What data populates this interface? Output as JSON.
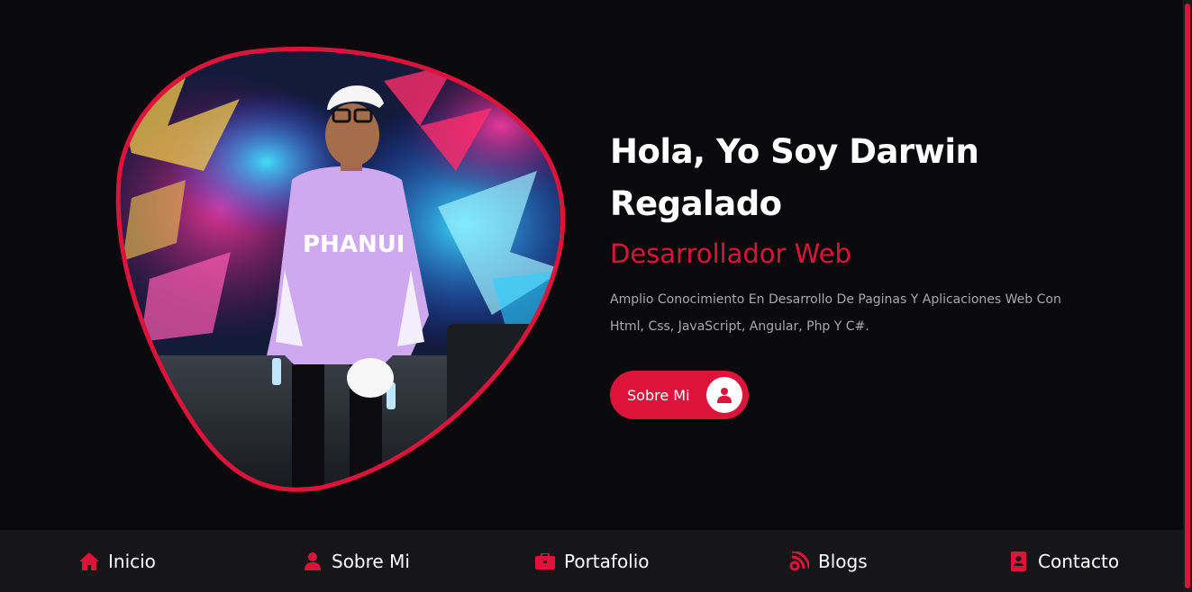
{
  "hero": {
    "title": "Hola, Yo Soy Darwin Regalado",
    "subtitle": "Desarrollador Web",
    "description": "Amplio Conocimiento En Desarrollo De Paginas Y Aplicaciones Web Con Html, Css, JavaScript, Angular, Php Y C#.",
    "button_label": "Sobre Mi",
    "button_icon": "user-icon",
    "photo": "profile-photo"
  },
  "navbar": {
    "items": [
      {
        "label": "Inicio",
        "icon": "home-icon"
      },
      {
        "label": "Sobre Mi",
        "icon": "user-icon"
      },
      {
        "label": "Portafolio",
        "icon": "briefcase-icon"
      },
      {
        "label": "Blogs",
        "icon": "blog-icon"
      },
      {
        "label": "Contacto",
        "icon": "address-book-icon"
      }
    ]
  },
  "colors": {
    "accent": "#dc143c",
    "background": "#0a090b",
    "navbar_background": "#161618",
    "text": "#ffffff",
    "muted_text": "#a9a9ae"
  }
}
